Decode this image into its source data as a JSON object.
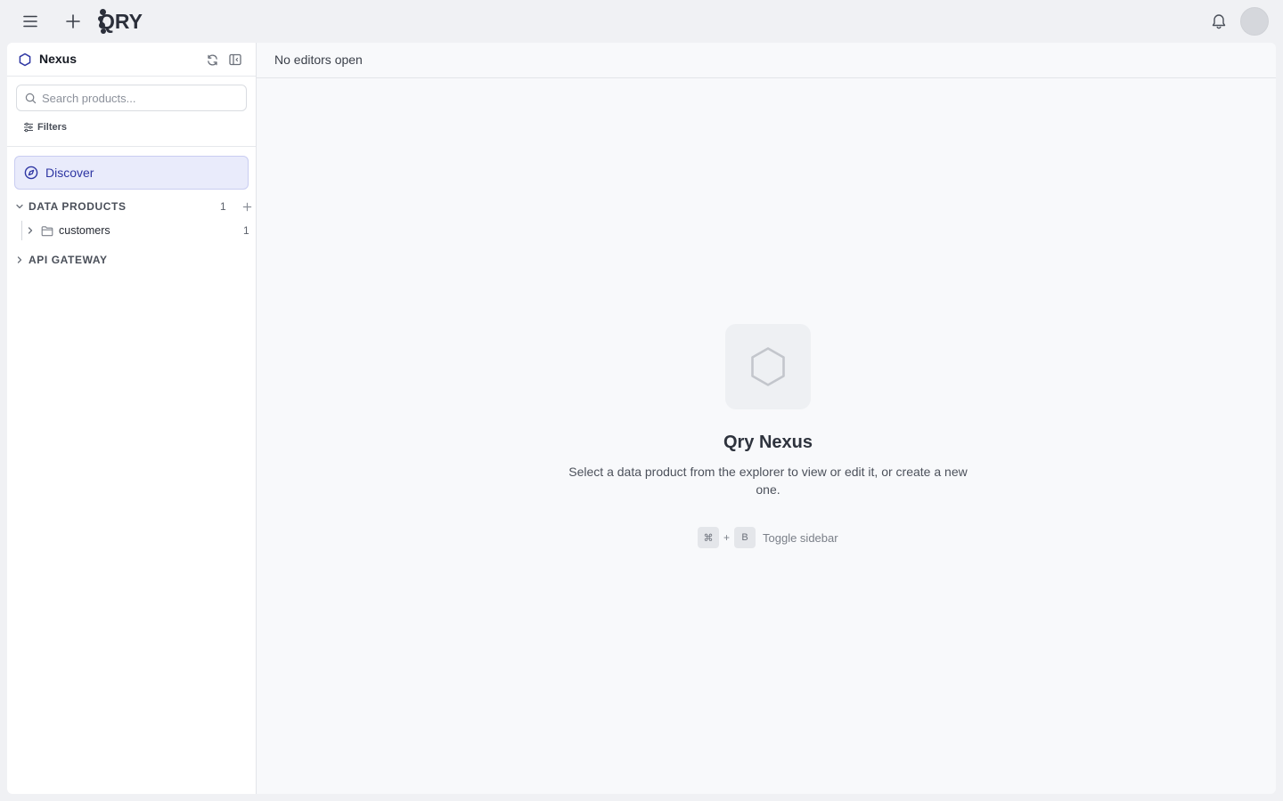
{
  "topbar": {
    "brand": "QRY",
    "icons": [
      "menu-icon",
      "plus-icon",
      "bell-icon"
    ]
  },
  "sidebar": {
    "title": "Nexus",
    "search_placeholder": "Search products...",
    "filters_label": "Filters",
    "discover_label": "Discover",
    "sections": [
      {
        "label": "DATA PRODUCTS",
        "expanded": true,
        "count": "1",
        "items": [
          {
            "label": "customers",
            "count": "1"
          }
        ]
      },
      {
        "label": "API GATEWAY",
        "expanded": false
      }
    ]
  },
  "main": {
    "tabstrip_text": "No editors open",
    "empty_title": "Qry Nexus",
    "empty_description": "Select a data product from the explorer to view or edit it, or create a new one.",
    "shortcut": {
      "key1": "⌘",
      "joiner": "+",
      "key2": "B",
      "label": "Toggle sidebar"
    }
  },
  "colors": {
    "accent": "#2e36a3",
    "accent_bg": "#e9ebfb",
    "app_bg": "#f0f1f4"
  }
}
